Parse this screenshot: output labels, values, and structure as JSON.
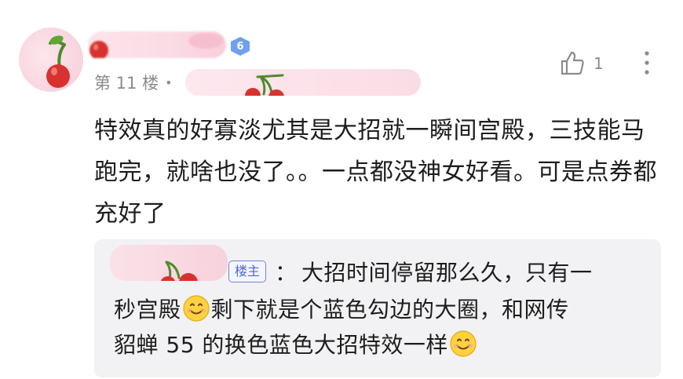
{
  "comment": {
    "level": "6",
    "floor": "第 11 楼",
    "separator": "•",
    "likes": "1",
    "text": "特效真的好寡淡尤其是大招就一瞬间宫殿，三技能马跑完，就啥也没了。。一点都没神女好看。可是点券都充好了"
  },
  "reply": {
    "host_badge": "楼主",
    "colon": "：",
    "line1": "大招时间停留那么久，只有一",
    "line2_a": "秒宫殿",
    "line2_b": "剩下就是个蓝色勾边的大圈，和网传",
    "line3": "貂蝉 55 的换色蓝色大招特效一样"
  },
  "icons": {
    "like": "thumbs-up-icon",
    "more": "more-vertical-icon",
    "emoji": "smile-emoji-icon",
    "avatar_deco": "cherry-icon"
  },
  "colors": {
    "pink_blur": "#fbdbe4",
    "badge_blue": "#6fa0ee",
    "host_blue": "#4f66c9",
    "reply_bg": "#f2f2f4",
    "cherry_red": "#d8322f"
  }
}
